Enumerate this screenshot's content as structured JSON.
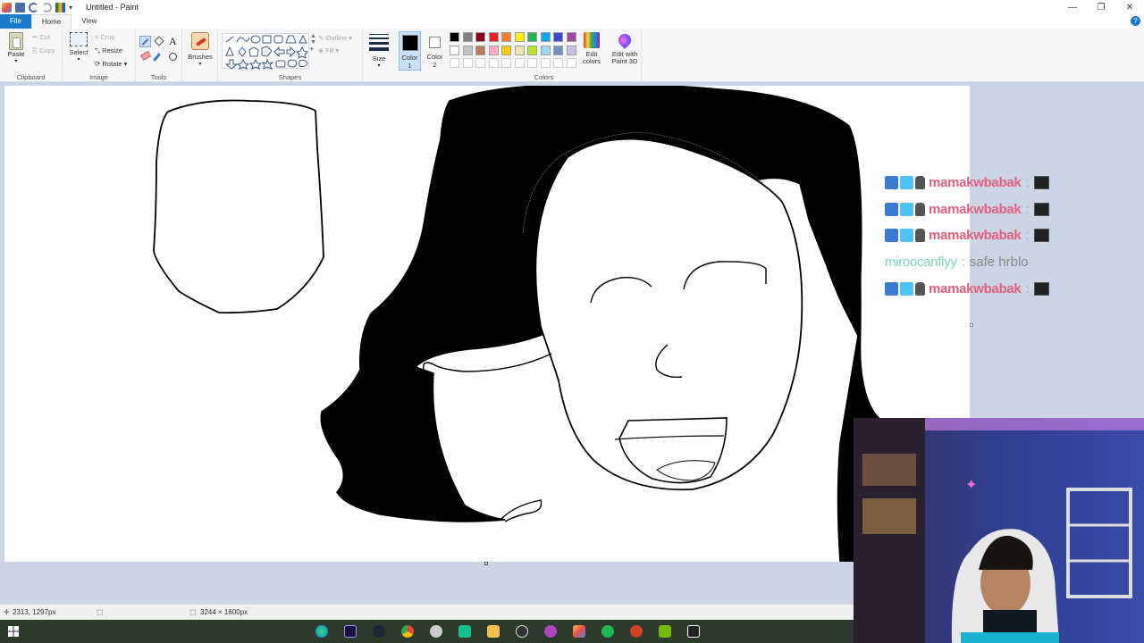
{
  "window": {
    "title": "Untitled - Paint",
    "controls": {
      "minimize": "—",
      "maximize": "❐",
      "close": "✕"
    }
  },
  "tabs": [
    {
      "label": "File"
    },
    {
      "label": "Home"
    },
    {
      "label": "View"
    }
  ],
  "ribbon": {
    "clipboard": {
      "paste": "Paste",
      "cut": "Cut",
      "copy": "Copy",
      "label": "Clipboard"
    },
    "image": {
      "select": "Select",
      "crop": "Crop",
      "resize": "Resize",
      "rotate": "Rotate",
      "label": "Image"
    },
    "tools": {
      "label": "Tools"
    },
    "brushes": {
      "label": "Brushes"
    },
    "shapes": {
      "outline": "Outline",
      "fill": "Fill",
      "label": "Shapes"
    },
    "size": {
      "label": "Size"
    },
    "color1": {
      "label": "Color",
      "sub": "1"
    },
    "color2": {
      "label": "Color",
      "sub": "2"
    },
    "colors": {
      "label": "Colors",
      "edit": "Edit colors",
      "edit_3d": "Edit with Paint 3D"
    },
    "palette": [
      "#000000",
      "#7f7f7f",
      "#880015",
      "#ed1c24",
      "#ff7f27",
      "#fff200",
      "#22b14c",
      "#00a2e8",
      "#3f48cc",
      "#a349a4",
      "#ffffff",
      "#c3c3c3",
      "#b97a57",
      "#ffaec9",
      "#ffc90e",
      "#efe4b0",
      "#b5e61d",
      "#99d9ea",
      "#7092be",
      "#c8bfe7"
    ]
  },
  "chat": [
    {
      "user": "mamakwbabak",
      "message": "",
      "user_color": "#e0607e",
      "badges": true,
      "emote": true
    },
    {
      "user": "mamakwbabak",
      "message": "",
      "user_color": "#e0607e",
      "badges": true,
      "emote": true
    },
    {
      "user": "mamakwbabak",
      "message": "",
      "user_color": "#e0607e",
      "badges": true,
      "emote": true
    },
    {
      "user": "miroocanflyy",
      "message": "safe hrblo",
      "user_color": "#7fd6b9",
      "badges": false,
      "emote": false
    },
    {
      "user": "mamakwbabak",
      "message": "",
      "user_color": "#e0607e",
      "badges": true,
      "emote": true
    }
  ],
  "status": {
    "cursor_pos": "2313, 1297px",
    "canvas_size": "3244 × 1600px"
  }
}
